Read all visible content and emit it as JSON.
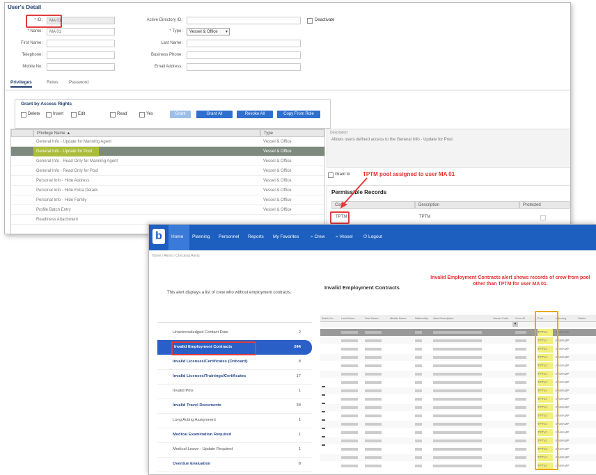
{
  "user_detail": {
    "title": "User's Detail",
    "fields": {
      "id_label": "* ID:",
      "id_value": "MA 01",
      "name_label": "* Name:",
      "name_value": "MA 01",
      "first_name_label": "First Name:",
      "telephone_label": "Telephone:",
      "mobile_label": "Mobile No:",
      "active_directory_label": "Active Directory ID:",
      "deactivate_label": "Deactivate",
      "type_label": "* Type:",
      "type_value": "Vessel & Office",
      "last_name_label": "Last Name:",
      "business_phone_label": "Business Phone:",
      "email_label": "Email Address:"
    },
    "tabs": [
      "Privileges",
      "Roles",
      "Password"
    ],
    "grant": {
      "title": "Grant by Access Rights",
      "options": [
        "Delete",
        "Insert",
        "Edit",
        "Read",
        "Yes"
      ],
      "grant_label": "Grant",
      "grant_all_label": "Grant All",
      "revoke_all_label": "Revoke All",
      "copy_from_role_label": "Copy From Role"
    },
    "privileges_table": {
      "headers": [
        "Privilege Name",
        "Type"
      ],
      "rows": [
        {
          "name": "General Info - Update for Manning Agent",
          "type": "Vessel & Office"
        },
        {
          "name": "General Info - Update for Pool",
          "type": "Vessel & Office"
        },
        {
          "name": "General Info - Read Only for Manning Agent",
          "type": "Vessel & Office"
        },
        {
          "name": "General Info - Read Only for Pool",
          "type": "Vessel & Office"
        },
        {
          "name": "Personal Info - Hide Address",
          "type": "Vessel & Office"
        },
        {
          "name": "Personal Info - Hide Extra Details",
          "type": "Vessel & Office"
        },
        {
          "name": "Personal Info - Hide Family",
          "type": "Vessel & Office"
        },
        {
          "name": "Profile Batch Entry",
          "type": "Vessel & Office"
        },
        {
          "name": "Readiness Attachment",
          "type": ""
        }
      ]
    },
    "description": {
      "label": "Description:",
      "text": "Allows users defined access to the General Info - Update for Pool."
    },
    "grant_to_label": "Grant to",
    "annotation_pool": "TPTM pool assigned to user MA 01",
    "permissible": {
      "title": "Permissible Records",
      "headers": [
        "Code",
        "Description",
        "Protected"
      ],
      "rows": [
        {
          "code": "TPTM",
          "description": "TPTM"
        }
      ]
    }
  },
  "alerts": {
    "nav": [
      "Home",
      "Planning",
      "Personnel",
      "Reports",
      "My Favorites",
      "Crew",
      "Vessel",
      "Logout"
    ],
    "breadcrumb": "Home \\ Alerts \\ Checking Alerts",
    "description": "This alert displays a list of crew who without employment contracts.",
    "table_title": "Invalid Employment Contracts",
    "annotation": "Invalid Employment Contracts alert shows records of crew from pool other than TPTM for user MA 01.",
    "alert_list": [
      {
        "label": "Unacknowledged Contact Date",
        "count": "2"
      },
      {
        "label": "Invalid Employment Contracts",
        "count": "244"
      },
      {
        "label": "Invalid Licenses/Certificates (Onboard)",
        "count": "8"
      },
      {
        "label": "Invalid Licenses/Trainings/Certificates",
        "count": "17"
      },
      {
        "label": "Invalid Pins",
        "count": "1"
      },
      {
        "label": "Invalid Travel Documents",
        "count": "38"
      },
      {
        "label": "Long Acting Assignment",
        "count": "1"
      },
      {
        "label": "Medical Examination Required",
        "count": "1"
      },
      {
        "label": "Medical Leave - Update Required",
        "count": "1"
      },
      {
        "label": "Overdue Evaluation",
        "count": "8"
      }
    ],
    "table_headers": [
      "Batch No",
      "Last Name",
      "First Name",
      "Middle Name",
      "Nationality",
      "Alert Description",
      "Vessel Code",
      "Crew ID",
      "Pool",
      "Manning",
      "Status"
    ],
    "pool_value": "TPTVJ",
    "manning_value": "BAMAMP",
    "row_count": 17,
    "colors": {
      "nav": "#1c5fbf",
      "highlight": "#e23b3b",
      "selected_row": "#aabd3a"
    }
  }
}
